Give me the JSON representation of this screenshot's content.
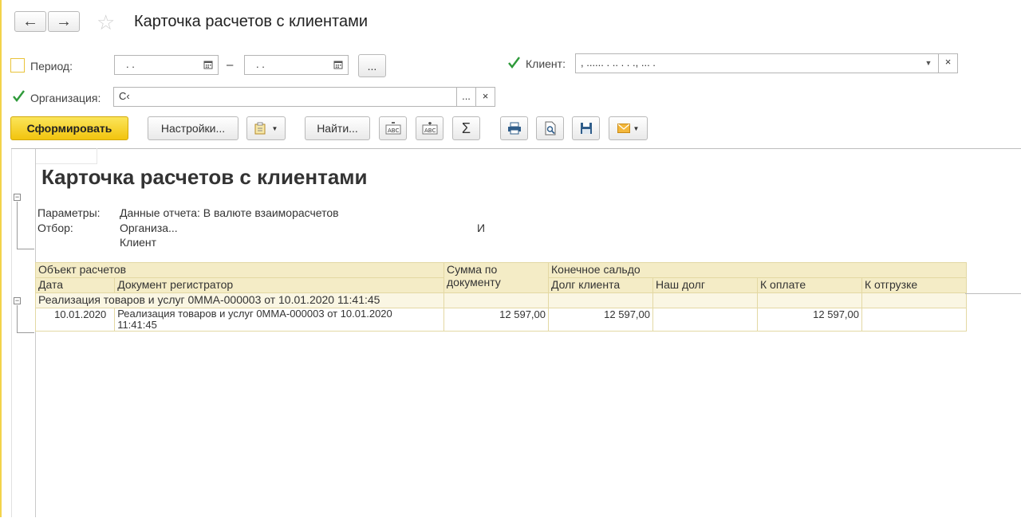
{
  "window": {
    "title": "Карточка расчетов с клиентами",
    "nav_back": "←",
    "nav_forward": "→",
    "favorite_icon": "☆"
  },
  "filters": {
    "period": {
      "label": "Период:",
      "checked": false,
      "from": ". .",
      "to": ". .",
      "separator": "–",
      "more": "..."
    },
    "client": {
      "label": "Клиент:",
      "checked": true,
      "value": ", ...... . .. .      .       ., ... ."
    },
    "organization": {
      "label": "Организация:",
      "checked": true,
      "value": "С‹",
      "more": "...",
      "clear": "×"
    }
  },
  "toolbar": {
    "generate": "Сформировать",
    "settings": "Настройки...",
    "find": "Найти...",
    "sum": "Σ"
  },
  "report": {
    "title": "Карточка расчетов с клиентами",
    "params_label": "Параметры:",
    "params_value": "Данные отчета: В валюте взаиморасчетов",
    "filter_label": "Отбор:",
    "filter_org": "Организа...",
    "filter_org_tail": "И",
    "filter_client": "Клиент",
    "headers": {
      "object": "Объект расчетов",
      "date": "Дата",
      "doc": "Документ регистратор",
      "sum_doc_1": "Сумма по",
      "sum_doc_2": "документу",
      "final_balance": "Конечное сальдо",
      "client_debt": "Долг клиента",
      "our_debt": "Наш долг",
      "to_pay": "К оплате",
      "to_ship": "К отгрузке"
    },
    "group_row": "Реализация товаров и услуг 0ММА-000003 от 10.01.2020 11:41:45",
    "rows": [
      {
        "date": "10.01.2020",
        "doc_line1": "Реализация товаров и услуг 0ММА-000003 от 10.01.2020",
        "doc_line2": "11:41:45",
        "sum": "12 597,00",
        "client_debt": "12 597,00",
        "our_debt": "",
        "to_pay": "12 597,00",
        "to_ship": ""
      }
    ]
  },
  "colors": {
    "accent": "#f2c40e",
    "header_bg": "#f4ecc6",
    "check_green": "#2e9a3a"
  }
}
